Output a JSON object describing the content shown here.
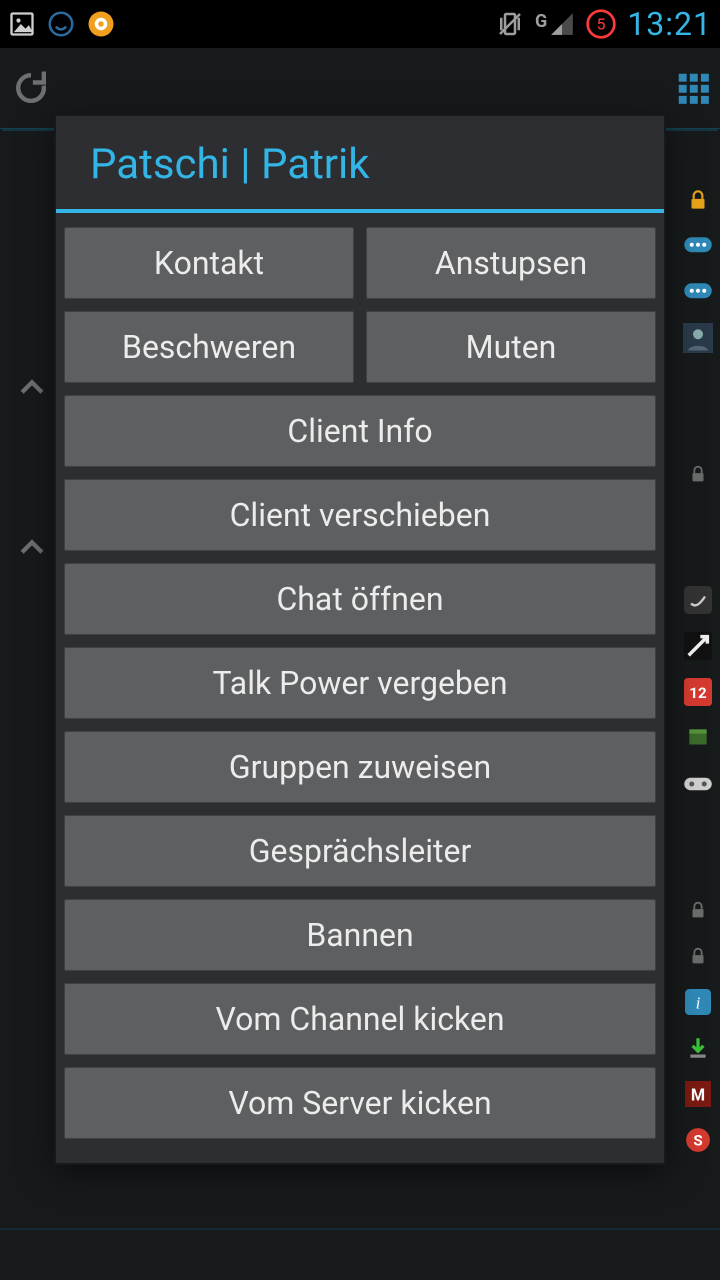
{
  "status": {
    "clock": "13:21",
    "notif_count": "5",
    "net_label": "G"
  },
  "dialog": {
    "title": "Patschi | Patrik",
    "row1": {
      "left": "Kontakt",
      "right": "Anstupsen"
    },
    "row2": {
      "left": "Beschweren",
      "right": "Muten"
    },
    "buttons": [
      "Client Info",
      "Client verschieben",
      "Chat öffnen",
      "Talk Power vergeben",
      "Gruppen zuweisen",
      "Gesprächsleiter",
      "Bannen",
      "Vom Channel kicken",
      "Vom Server kicken"
    ]
  },
  "rail_icons": [
    "lock-icon",
    "chat-icon",
    "chat-icon",
    "avatar-icon",
    "lock-icon-grey",
    "app-icon",
    "app-icon",
    "badge-12-icon",
    "block-icon",
    "gamepad-icon",
    "lock-icon-grey",
    "lock-icon-grey",
    "info-icon",
    "download-icon",
    "m-icon",
    "skype-icon"
  ]
}
